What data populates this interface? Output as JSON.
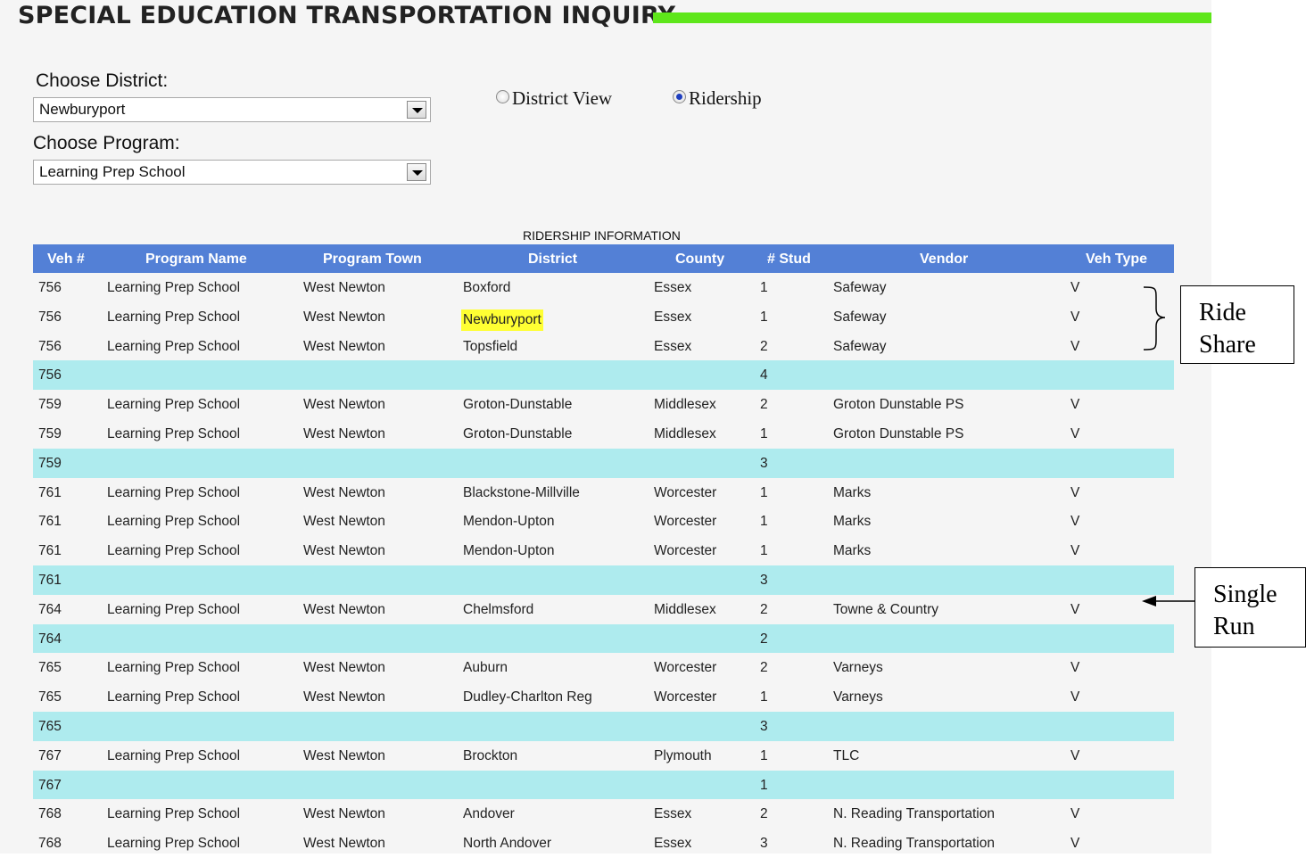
{
  "page": {
    "title": "SPECIAL EDUCATION TRANSPORTATION INQUIRY",
    "accent_color": "#5ee61a"
  },
  "filters": {
    "district_label": "Choose District:",
    "district_value": "Newburyport",
    "program_label": "Choose Program:",
    "program_value": "Learning Prep School"
  },
  "view_options": {
    "district_view": "District View",
    "ridership": "Ridership",
    "selected": "Ridership"
  },
  "table": {
    "caption": "RIDERSHIP INFORMATION",
    "header_color": "#5380d6",
    "subtotal_color": "#aeebee",
    "columns": [
      "Veh #",
      "Program Name",
      "Program Town",
      "District",
      "County",
      "# Stud",
      "Vendor",
      "Veh Type"
    ],
    "rows": [
      {
        "type": "detail",
        "cells": [
          "756",
          "Learning Prep School",
          "West Newton",
          "Boxford",
          "Essex",
          "1",
          "Safeway",
          "V"
        ]
      },
      {
        "type": "detail",
        "cells": [
          "756",
          "Learning Prep School",
          "West Newton",
          "Newburyport",
          "Essex",
          "1",
          "Safeway",
          "V"
        ],
        "highlight_district": true
      },
      {
        "type": "detail",
        "cells": [
          "756",
          "Learning Prep School",
          "West Newton",
          "Topsfield",
          "Essex",
          "2",
          "Safeway",
          "V"
        ]
      },
      {
        "type": "subtotal",
        "cells": [
          "756",
          "",
          "",
          "",
          "",
          "4",
          "",
          ""
        ]
      },
      {
        "type": "detail",
        "cells": [
          "759",
          "Learning Prep School",
          "West Newton",
          "Groton-Dunstable",
          "Middlesex",
          "2",
          "Groton Dunstable PS",
          "V"
        ]
      },
      {
        "type": "detail",
        "cells": [
          "759",
          "Learning Prep School",
          "West Newton",
          "Groton-Dunstable",
          "Middlesex",
          "1",
          "Groton Dunstable PS",
          "V"
        ]
      },
      {
        "type": "subtotal",
        "cells": [
          "759",
          "",
          "",
          "",
          "",
          "3",
          "",
          ""
        ]
      },
      {
        "type": "detail",
        "cells": [
          "761",
          "Learning Prep School",
          "West Newton",
          "Blackstone-Millville",
          "Worcester",
          "1",
          "Marks",
          "V"
        ]
      },
      {
        "type": "detail",
        "cells": [
          "761",
          "Learning Prep School",
          "West Newton",
          "Mendon-Upton",
          "Worcester",
          "1",
          "Marks",
          "V"
        ]
      },
      {
        "type": "detail",
        "cells": [
          "761",
          "Learning Prep School",
          "West Newton",
          "Mendon-Upton",
          "Worcester",
          "1",
          "Marks",
          "V"
        ]
      },
      {
        "type": "subtotal",
        "cells": [
          "761",
          "",
          "",
          "",
          "",
          "3",
          "",
          ""
        ]
      },
      {
        "type": "detail",
        "cells": [
          "764",
          "Learning Prep School",
          "West Newton",
          "Chelmsford",
          "Middlesex",
          "2",
          "Towne & Country",
          "V"
        ]
      },
      {
        "type": "subtotal",
        "cells": [
          "764",
          "",
          "",
          "",
          "",
          "2",
          "",
          ""
        ]
      },
      {
        "type": "detail",
        "cells": [
          "765",
          "Learning Prep School",
          "West Newton",
          "Auburn",
          "Worcester",
          "2",
          "Varneys",
          "V"
        ]
      },
      {
        "type": "detail",
        "cells": [
          "765",
          "Learning Prep School",
          "West Newton",
          "Dudley-Charlton Reg",
          "Worcester",
          "1",
          "Varneys",
          "V"
        ]
      },
      {
        "type": "subtotal",
        "cells": [
          "765",
          "",
          "",
          "",
          "",
          "3",
          "",
          ""
        ]
      },
      {
        "type": "detail",
        "cells": [
          "767",
          "Learning Prep School",
          "West Newton",
          "Brockton",
          "Plymouth",
          "1",
          "TLC",
          "V"
        ]
      },
      {
        "type": "subtotal",
        "cells": [
          "767",
          "",
          "",
          "",
          "",
          "1",
          "",
          ""
        ]
      },
      {
        "type": "detail",
        "cells": [
          "768",
          "Learning Prep School",
          "West Newton",
          "Andover",
          "Essex",
          "2",
          "N. Reading Transportation",
          "V"
        ]
      },
      {
        "type": "detail",
        "cells": [
          "768",
          "Learning Prep School",
          "West Newton",
          "North Andover",
          "Essex",
          "3",
          "N. Reading Transportation",
          "V"
        ]
      }
    ]
  },
  "annotations": {
    "ride_share": [
      "Ride",
      "Share"
    ],
    "single_run": [
      "Single",
      "Run"
    ]
  }
}
